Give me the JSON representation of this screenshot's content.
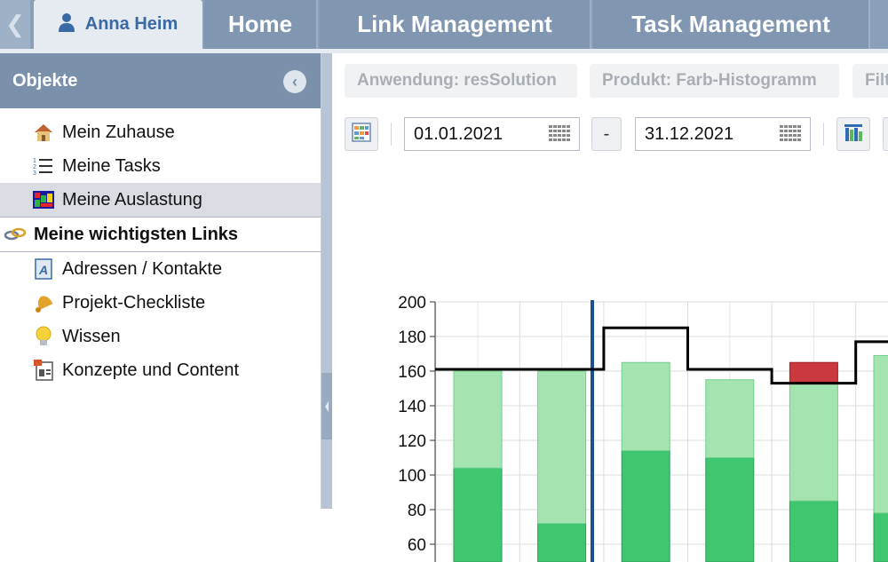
{
  "tabs": {
    "user": "Anna Heim",
    "home": "Home",
    "link_management": "Link Management",
    "task_management": "Task Management"
  },
  "sidebar": {
    "title": "Objekte",
    "items": [
      {
        "label": "Mein Zuhause",
        "icon": "house-icon"
      },
      {
        "label": "Meine Tasks",
        "icon": "task-list-icon"
      },
      {
        "label": "Meine Auslastung",
        "icon": "workload-chart-icon"
      }
    ],
    "section": {
      "label": "Meine wichtigsten Links",
      "icon": "links-icon"
    },
    "links": [
      {
        "label": "Adressen / Kontakte",
        "icon": "address-book-icon"
      },
      {
        "label": "Projekt-Checkliste",
        "icon": "checklist-bell-icon"
      },
      {
        "label": "Wissen",
        "icon": "lightbulb-icon"
      },
      {
        "label": "Konzepte und Content",
        "icon": "document-icon"
      }
    ]
  },
  "toolbar": {
    "filter_application": "Anwendung: resSolution",
    "filter_product": "Produkt: Farb-Histogramm",
    "filter_more": "Filt",
    "date_from": "01.01.2021",
    "date_separator": "-",
    "date_to": "31.12.2021"
  },
  "colors": {
    "tab_bg": "#8196b0",
    "sidebar_header": "#7b90ab",
    "bar_dark": "#3fc671",
    "bar_light": "#a3e4b1",
    "bar_over": "#c9393f",
    "today_line": "#1b4f96",
    "capacity_line": "#000000"
  },
  "chart_data": {
    "type": "bar",
    "ylim": [
      50,
      200
    ],
    "yticks": [
      60,
      80,
      100,
      120,
      140,
      160,
      180,
      200
    ],
    "stacks": [
      {
        "dark": 104,
        "light": 56,
        "over": 0
      },
      {
        "dark": 72,
        "light": 88,
        "over": 0
      },
      {
        "dark": 114,
        "light": 51,
        "over": 0
      },
      {
        "dark": 110,
        "light": 45,
        "over": 0
      },
      {
        "dark": 85,
        "light": 68,
        "over": 12
      },
      {
        "dark": 78,
        "light": 91,
        "over": 0
      }
    ],
    "capacity": [
      161,
      161,
      185,
      161,
      153,
      177
    ]
  }
}
